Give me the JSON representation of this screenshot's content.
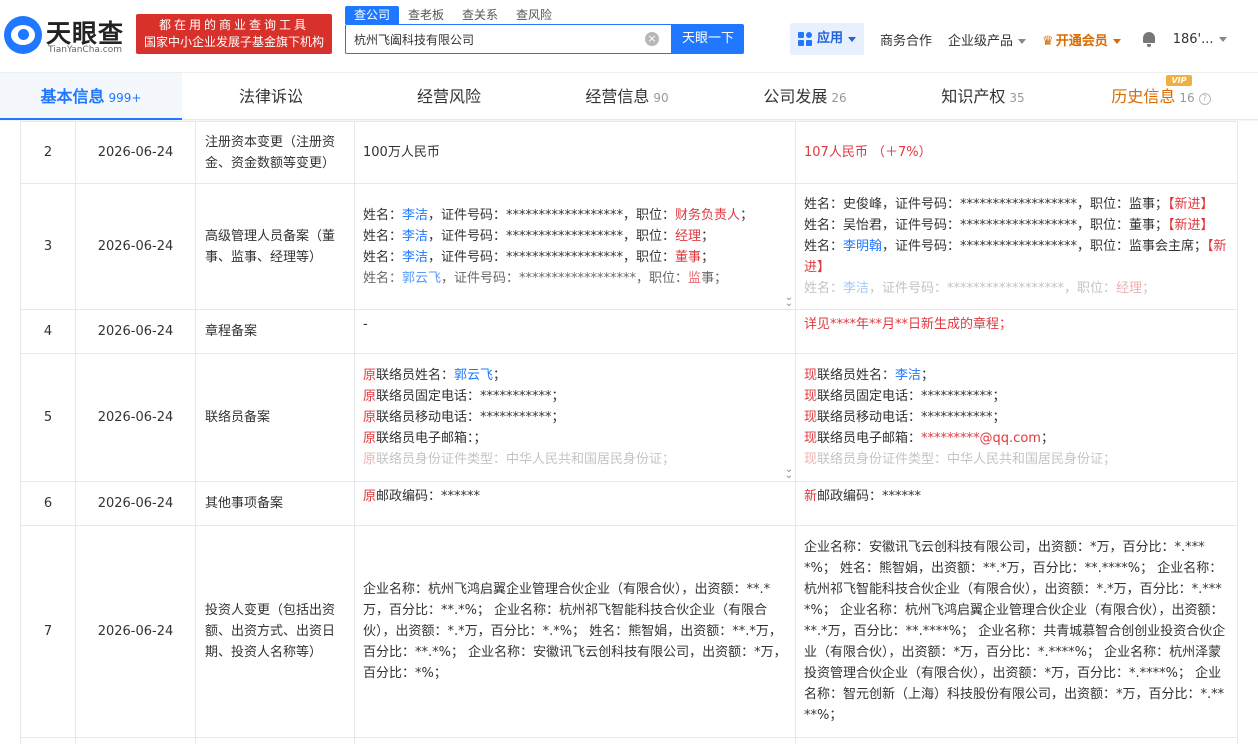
{
  "logo": {
    "name": "天眼查",
    "domain": "TianYanCha.com"
  },
  "slogan": {
    "line1": "都在用的商业查询工具",
    "line2": "国家中小企业发展子基金旗下机构"
  },
  "search": {
    "tabs": [
      "查公司",
      "查老板",
      "查关系",
      "查风险"
    ],
    "value": "杭州飞阖科技有限公司",
    "button": "天眼一下"
  },
  "nav": {
    "apps": "应用",
    "business": "商务合作",
    "enterprise": "企业级产品",
    "vip": "开通会员",
    "user": "186'..."
  },
  "tabs": [
    {
      "label": "基本信息",
      "count": "999+"
    },
    {
      "label": "法律诉讼",
      "count": ""
    },
    {
      "label": "经营风险",
      "count": ""
    },
    {
      "label": "经营信息",
      "count": "90"
    },
    {
      "label": "公司发展",
      "count": "26"
    },
    {
      "label": "知识产权",
      "count": "35"
    },
    {
      "label": "历史信息",
      "count": "16"
    }
  ],
  "vip_badge": "VIP",
  "rows": [
    {
      "no": "2",
      "date": "2026-06-24",
      "item": "注册资本变更（注册资金、资金数额等变更）",
      "before": "100万人民币",
      "after": "107人民币 （＋7%）"
    },
    {
      "no": "3",
      "date": "2026-06-24",
      "item": "高级管理人员备案（董事、监事、经理等）",
      "before_lines": [
        {
          "a": "姓名：",
          "name": "李洁",
          "b": "，证件号码：******************，职位：",
          "pos": "财务负责人",
          "c": "；"
        },
        {
          "a": "姓名：",
          "name": "李洁",
          "b": "，证件号码：******************，职位：",
          "pos": "经理",
          "c": "；"
        },
        {
          "a": "姓名：",
          "name": "李洁",
          "b": "，证件号码：******************，职位：",
          "pos": "董事",
          "c": "；"
        },
        {
          "a": "姓名：",
          "name": "郭云飞",
          "b": "，证件号码：******************，职位：",
          "pos": "监",
          "c": "事；"
        }
      ],
      "after_lines": [
        {
          "a": "姓名：史俊峰，证件号码：******************，职位：监事；",
          "tag": "【新进】"
        },
        {
          "a": "姓名：吴怡君，证件号码：******************，职位：董事；",
          "tag": "【新进】"
        },
        {
          "a": "姓名：",
          "name": "李明翰",
          "b": "，证件号码：******************，职位：监事会主席；",
          "tag": "【新进】"
        }
      ],
      "after_fade": {
        "a": "姓名：",
        "name": "李洁",
        "b": "，证件号码：******************，职位：",
        "pos": "经理",
        "c": "；"
      }
    },
    {
      "no": "4",
      "date": "2026-06-24",
      "item": "章程备案",
      "before": "-",
      "after": "详见****年**月**日新生成的章程；"
    },
    {
      "no": "5",
      "date": "2026-06-24",
      "item": "联络员备案",
      "prefix_before": "原",
      "prefix_after": "现",
      "before_lines": [
        {
          "label": "联络员姓名：",
          "value": "郭云飞",
          "end": "；"
        },
        {
          "label": "联络员固定电话：***********；"
        },
        {
          "label": "联络员移动电话：***********；"
        },
        {
          "label": "联络员电子邮箱：；"
        }
      ],
      "before_fade": "联络员身份证件类型：中华人民共和国居民身份证；",
      "after_lines": [
        {
          "label": "联络员姓名：",
          "value": "李洁",
          "end": "；"
        },
        {
          "label": "联络员固定电话：***********；"
        },
        {
          "label": "联络员移动电话：***********；"
        },
        {
          "label": "联络员电子邮箱：",
          "email": "*********@qq.com",
          "end": "；"
        }
      ],
      "after_fade": "联络员身份证件类型：中华人民共和国居民身份证；"
    },
    {
      "no": "6",
      "date": "2026-06-24",
      "item": "其他事项备案",
      "before_prefix": "原",
      "before": "邮政编码：******",
      "after_prefix": "新",
      "after": "邮政编码：******"
    },
    {
      "no": "7",
      "date": "2026-06-24",
      "item": "投资人变更（包括出资额、出资方式、出资日期、投资人名称等）",
      "before": "企业名称：杭州飞鸿启翼企业管理合伙企业（有限合伙），出资额：**.*万，百分比：**.*%； 企业名称：杭州祁飞智能科技合伙企业（有限合伙），出资额：*.*万，百分比：*.*%； 姓名：熊智娟，出资额：**.*万，百分比：**.*%； 企业名称：安徽讯飞云创科技有限公司，出资额：*万，百分比：*%；",
      "after": "企业名称：安徽讯飞云创科技有限公司，出资额：*万，百分比：*.****%； 姓名：熊智娟，出资额：**.*万，百分比：**.****%； 企业名称：杭州祁飞智能科技合伙企业（有限合伙），出资额：*.*万，百分比：*.****%； 企业名称：杭州飞鸿启翼企业管理合伙企业（有限合伙），出资额：**.*万，百分比：**.****%； 企业名称：共青城慕智合创创业投资合伙企业（有限合伙），出资额：*万，百分比：*.****%； 企业名称：杭州泽蒙投资管理合伙企业（有限合伙），出资额：*万，百分比：*.****%； 企业名称：智元创新（上海）科技股份有限公司，出资额：*万，百分比：*.****%；"
    }
  ]
}
